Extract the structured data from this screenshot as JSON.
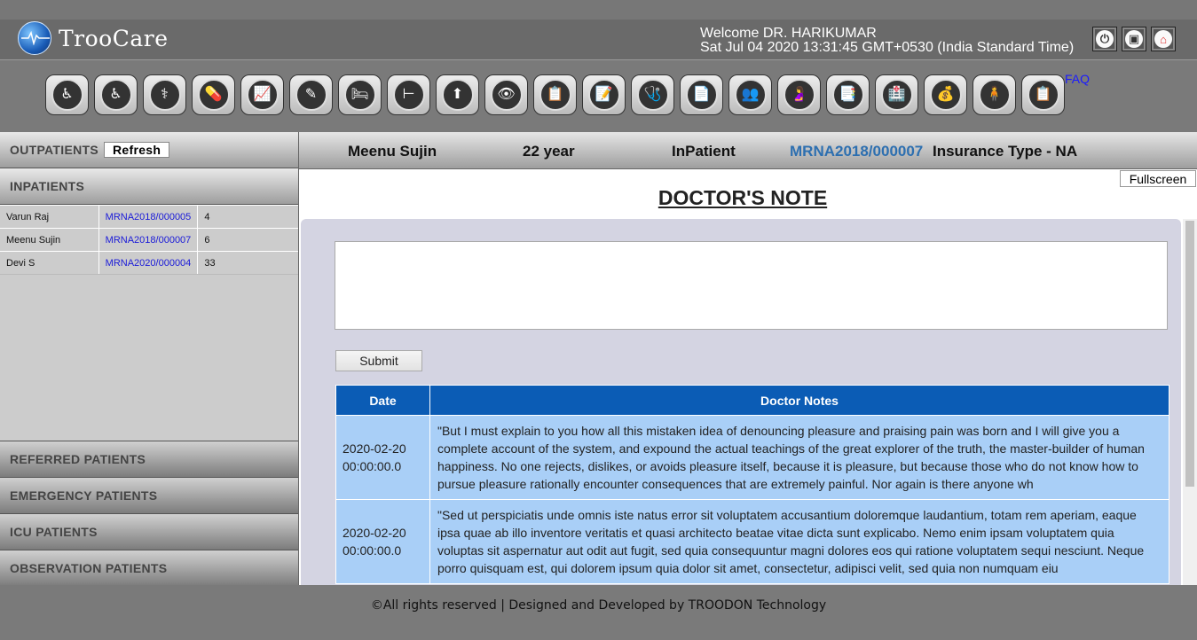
{
  "app": {
    "logo_text": "TrooCare"
  },
  "header": {
    "welcome": "Welcome DR. HARIKUMAR",
    "datetime": "Sat Jul 04 2020 13:31:45 GMT+0530 (India Standard Time)",
    "buttons": [
      {
        "name": "power-icon",
        "glyph": "⏻"
      },
      {
        "name": "lock-icon",
        "glyph": "🔒"
      },
      {
        "name": "home-icon",
        "glyph": "⌂"
      }
    ]
  },
  "toolbar": {
    "faq_label": "FAQ",
    "icons": [
      {
        "name": "outpatient-icon",
        "glyph": "♿"
      },
      {
        "name": "patient-register-icon",
        "glyph": "♿"
      },
      {
        "name": "stethoscope-icon",
        "glyph": "⚕"
      },
      {
        "name": "pill-icon",
        "glyph": "💊"
      },
      {
        "name": "monitor-icon",
        "glyph": "📈"
      },
      {
        "name": "lab-icon",
        "glyph": "✎"
      },
      {
        "name": "bed-icon",
        "glyph": "🛏"
      },
      {
        "name": "ward-icon",
        "glyph": "⊢"
      },
      {
        "name": "upload-icon",
        "glyph": "⬆"
      },
      {
        "name": "visit-icon",
        "glyph": "👁"
      },
      {
        "name": "clipboard-icon",
        "glyph": "📋"
      },
      {
        "name": "checklist-icon",
        "glyph": "📝"
      },
      {
        "name": "doctor-icon",
        "glyph": "🩺"
      },
      {
        "name": "report-icon",
        "glyph": "📄"
      },
      {
        "name": "staff-icon",
        "glyph": "👥"
      },
      {
        "name": "maternity-icon",
        "glyph": "🤰"
      },
      {
        "name": "insurance-icon",
        "glyph": "📑"
      },
      {
        "name": "discharge-icon",
        "glyph": "🏥"
      },
      {
        "name": "billing-icon",
        "glyph": "💰"
      },
      {
        "name": "patient-file-icon",
        "glyph": "🧍"
      },
      {
        "name": "record-icon",
        "glyph": "📋"
      }
    ]
  },
  "sidebar": {
    "outpatients_label": "OUTPATIENTS",
    "refresh_label": "Refresh",
    "inpatients_label": "INPATIENTS",
    "inpatients": [
      {
        "name": "Varun Raj",
        "mrn": "MRNA2018/000005",
        "count": "4"
      },
      {
        "name": "Meenu Sujin",
        "mrn": "MRNA2018/000007",
        "count": "6"
      },
      {
        "name": "Devi S",
        "mrn": "MRNA2020/000004",
        "count": "33"
      }
    ],
    "sections": [
      "REFERRED PATIENTS",
      "EMERGENCY PATIENTS",
      "ICU PATIENTS",
      "OBSERVATION PATIENTS"
    ]
  },
  "patient": {
    "name": "Meenu  Sujin",
    "age": "22  year",
    "type": "InPatient",
    "mrn": "MRNA2018/000007",
    "insurance": "Insurance Type - NA"
  },
  "main": {
    "fullscreen_label": "Fullscreen",
    "title": "DOCTOR'S NOTE",
    "note_value": "",
    "submit_label": "Submit",
    "table_headers": [
      "Date",
      "Doctor Notes"
    ],
    "notes": [
      {
        "date_line1": "2020-02-20",
        "date_line2": "00:00:00.0",
        "text": "\"But I must explain to you how all this mistaken idea of denouncing pleasure and praising pain was born and I will give you a complete account of the system, and expound the actual teachings of the great explorer of the truth, the master-builder of human happiness. No one rejects, dislikes, or avoids pleasure itself, because it is pleasure, but because those who do not know how to pursue pleasure rationally encounter consequences that are extremely painful. Nor again is there anyone wh"
      },
      {
        "date_line1": "2020-02-20",
        "date_line2": "00:00:00.0",
        "text": "\"Sed ut perspiciatis unde omnis iste natus error sit voluptatem accusantium doloremque laudantium, totam rem aperiam, eaque ipsa quae ab illo inventore veritatis et quasi architecto beatae vitae dicta sunt explicabo. Nemo enim ipsam voluptatem quia voluptas sit aspernatur aut odit aut fugit, sed quia consequuntur magni dolores eos qui ratione voluptatem sequi nesciunt. Neque porro quisquam est, qui dolorem ipsum quia dolor sit amet, consectetur, adipisci velit, sed quia non numquam eiu"
      }
    ]
  },
  "footer": {
    "text": "©All rights reserved | Designed and Developed by TROODON Technology"
  },
  "colors": {
    "header_bg": "#6a6a6a",
    "table_header_bg": "#0b5cb5",
    "table_row_bg": "#a9cff7",
    "panel_bg": "#d4d4e2",
    "link_blue": "#1a1ad8",
    "mrn_blue": "#2d6fb0"
  }
}
